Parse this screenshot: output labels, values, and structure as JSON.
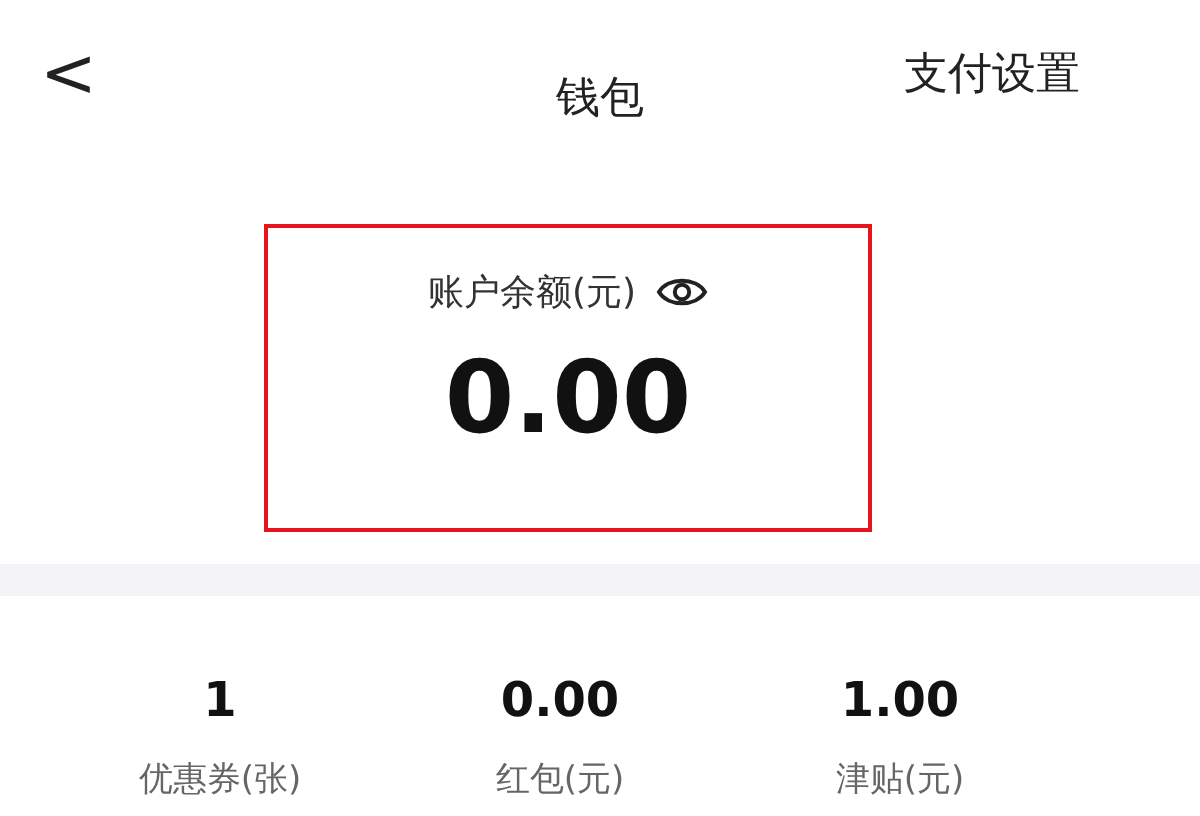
{
  "header": {
    "back": "<",
    "title": "钱包",
    "action": "支付设置"
  },
  "balance": {
    "label": "账户余额(元)",
    "amount": "0.00",
    "highlighted": true
  },
  "stats": [
    {
      "value": "1",
      "label": "优惠券(张)"
    },
    {
      "value": "0.00",
      "label": "红包(元)"
    },
    {
      "value": "1.00",
      "label": "津贴(元)"
    }
  ]
}
